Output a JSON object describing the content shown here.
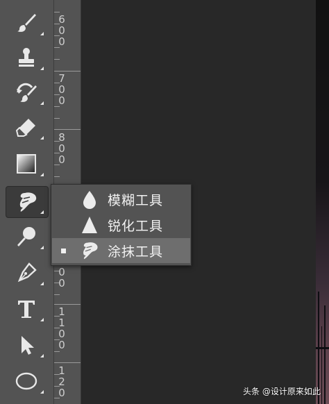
{
  "tools": [
    {
      "name": "brush-tool",
      "icon": "brush-icon"
    },
    {
      "name": "stamp-tool",
      "icon": "stamp-icon"
    },
    {
      "name": "history-brush-tool",
      "icon": "history-brush-icon"
    },
    {
      "name": "eraser-tool",
      "icon": "eraser-icon"
    },
    {
      "name": "gradient-tool",
      "icon": "gradient-icon"
    },
    {
      "name": "smudge-tool",
      "icon": "smudge-finger-icon",
      "active": true
    },
    {
      "name": "dodge-tool",
      "icon": "dodge-icon"
    },
    {
      "name": "pen-tool",
      "icon": "pen-icon"
    },
    {
      "name": "type-tool",
      "icon": "type-icon",
      "glyph": "T"
    },
    {
      "name": "path-selection-tool",
      "icon": "arrow-cursor-icon"
    },
    {
      "name": "ellipse-tool",
      "icon": "ellipse-icon"
    }
  ],
  "ruler": {
    "labels": [
      "6\n0\n0",
      "7\n0\n0",
      "8\n0\n0",
      "0\n0",
      "1\n1\n0\n0",
      "1\n2\n0"
    ]
  },
  "flyout": {
    "items": [
      {
        "label": "模糊工具",
        "icon": "blur-drop-icon",
        "selected": false
      },
      {
        "label": "锐化工具",
        "icon": "sharpen-triangle-icon",
        "selected": false
      },
      {
        "label": "涂抹工具",
        "icon": "smudge-finger-icon",
        "selected": true
      }
    ]
  },
  "watermark": "头条 @设计原来如此",
  "colors": {
    "panel": "#535353",
    "canvas": "#282828",
    "selected": "#6e6e6e",
    "icon": "#e8e8e8"
  }
}
